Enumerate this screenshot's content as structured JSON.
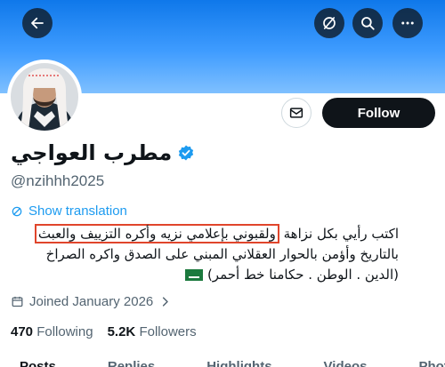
{
  "colors": {
    "accent": "#1d9bf0",
    "banner": "#1d8bf5",
    "follow_button_bg": "#0f1419",
    "highlight_box": "#e0452b"
  },
  "icons": {
    "back": "arrow-left-icon",
    "mute": "circle-slash-icon",
    "search": "search-icon",
    "more": "more-horizontal-icon",
    "message": "mail-icon",
    "verified": "verified-badge-icon",
    "translate": "translate-icon",
    "calendar": "calendar-icon",
    "chevron": "chevron-right-icon"
  },
  "profile": {
    "display_name": "مطرب العواجي",
    "handle": "@nzihhh2025",
    "follow_label": "Follow",
    "show_translation": "Show translation",
    "bio": {
      "line1_plain": "اكتب رأيي بكل نزاهة",
      "line1_highlight": "ولقبوني بإعلامي نزيه وأكره التزييف والعبث",
      "line2": "بالتاريخ وأؤمن بالحوار العقلاني المبني على الصدق واكره الصراخ",
      "line3": "(الدين . الوطن . حكامنا خط أحمر)"
    },
    "joined": "Joined January 2026",
    "following_count": "470",
    "following_label": "Following",
    "followers_count": "5.2K",
    "followers_label": "Followers"
  },
  "tabs": [
    "Posts",
    "Replies",
    "Highlights",
    "Videos",
    "Photos"
  ]
}
